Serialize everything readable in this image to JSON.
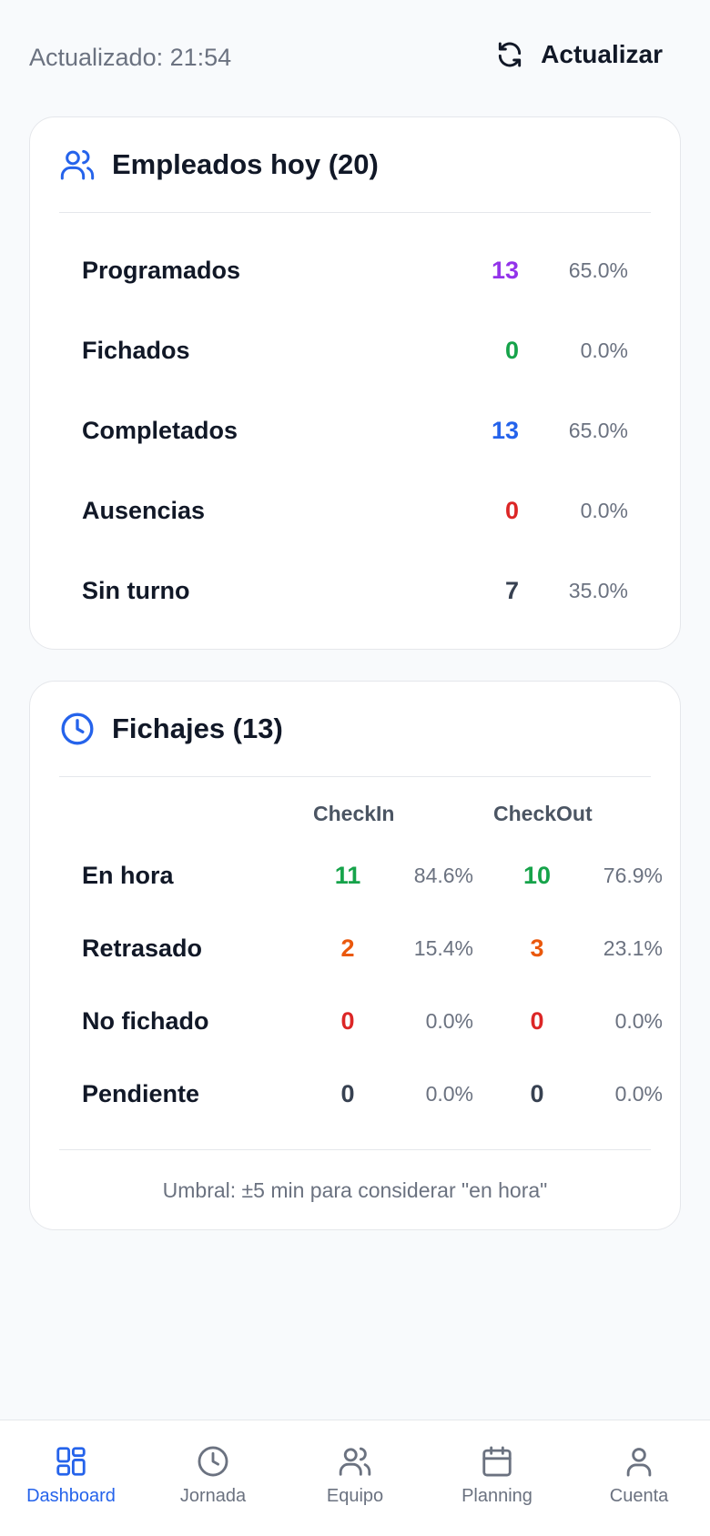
{
  "header": {
    "updated_text": "Actualizado: 21:54",
    "refresh_label": "Actualizar"
  },
  "employees_card": {
    "title": "Empleados hoy (20)",
    "icon": "users-icon",
    "rows": [
      {
        "label": "Programados",
        "value": "13",
        "percent": "65.0%",
        "color": "#9333ea"
      },
      {
        "label": "Fichados",
        "value": "0",
        "percent": "0.0%",
        "color": "#16a34a"
      },
      {
        "label": "Completados",
        "value": "13",
        "percent": "65.0%",
        "color": "#2563eb"
      },
      {
        "label": "Ausencias",
        "value": "0",
        "percent": "0.0%",
        "color": "#dc2626"
      },
      {
        "label": "Sin turno",
        "value": "7",
        "percent": "35.0%",
        "color": "#374151"
      }
    ]
  },
  "checks_card": {
    "title": "Fichajes (13)",
    "icon": "clock-icon",
    "col_checkin": "CheckIn",
    "col_checkout": "CheckOut",
    "rows": [
      {
        "label": "En hora",
        "in_value": "11",
        "in_percent": "84.6%",
        "out_value": "10",
        "out_percent": "76.9%",
        "color": "#16a34a"
      },
      {
        "label": "Retrasado",
        "in_value": "2",
        "in_percent": "15.4%",
        "out_value": "3",
        "out_percent": "23.1%",
        "color": "#ea580c"
      },
      {
        "label": "No fichado",
        "in_value": "0",
        "in_percent": "0.0%",
        "out_value": "0",
        "out_percent": "0.0%",
        "color": "#dc2626"
      },
      {
        "label": "Pendiente",
        "in_value": "0",
        "in_percent": "0.0%",
        "out_value": "0",
        "out_percent": "0.0%",
        "color": "#374151"
      }
    ],
    "footer": "Umbral: ±5 min para considerar \"en hora\""
  },
  "nav": {
    "items": [
      {
        "label": "Dashboard",
        "icon": "dashboard-icon",
        "active": true
      },
      {
        "label": "Jornada",
        "icon": "clock-icon",
        "active": false
      },
      {
        "label": "Equipo",
        "icon": "users-icon",
        "active": false
      },
      {
        "label": "Planning",
        "icon": "calendar-icon",
        "active": false
      },
      {
        "label": "Cuenta",
        "icon": "user-icon",
        "active": false
      }
    ],
    "active_color": "#2563eb"
  }
}
